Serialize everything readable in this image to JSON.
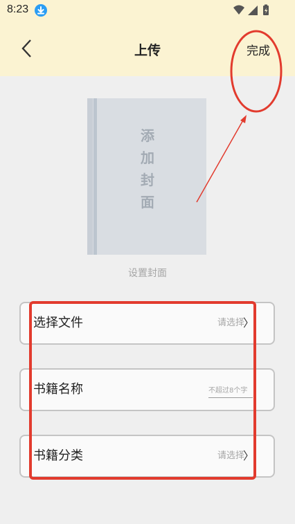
{
  "status_bar": {
    "time": "8:23"
  },
  "header": {
    "title": "上传",
    "done_label": "完成"
  },
  "cover": {
    "placeholder_text": "添加封面",
    "caption": "设置封面"
  },
  "form": {
    "fields": [
      {
        "label": "选择文件",
        "value": "请选择"
      },
      {
        "label": "书籍名称",
        "placeholder": "不超过8个字"
      },
      {
        "label": "书籍分类",
        "value": "请选择"
      }
    ]
  },
  "colors": {
    "header_bg": "#fbf3d2",
    "annotation": "#e23b2e"
  }
}
